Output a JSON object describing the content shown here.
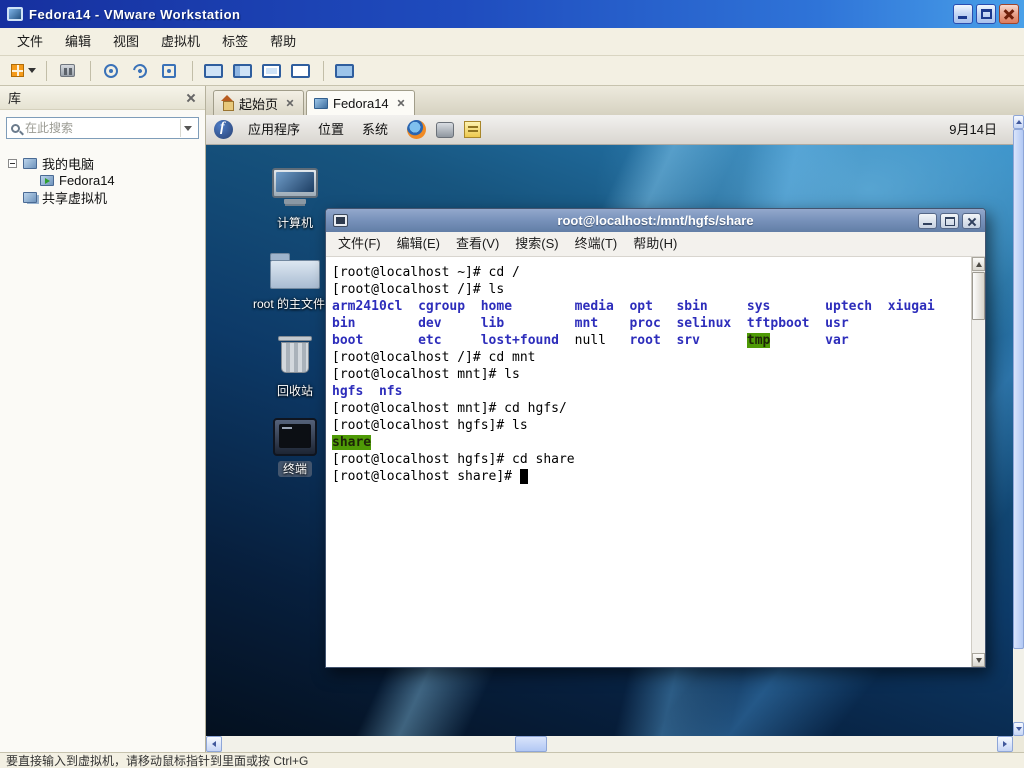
{
  "window": {
    "title": "Fedora14 - VMware Workstation",
    "menu": [
      "文件",
      "编辑",
      "视图",
      "虚拟机",
      "标签",
      "帮助"
    ]
  },
  "sidebar": {
    "title": "库",
    "search_placeholder": "在此搜索",
    "tree": {
      "my_computer": "我的电脑",
      "vm": "Fedora14",
      "shared": "共享虚拟机"
    }
  },
  "tabs": {
    "home": "起始页",
    "vm": "Fedora14"
  },
  "guest": {
    "panel": {
      "applications": "应用程序",
      "places": "位置",
      "system": "系统",
      "date": "9月14日"
    },
    "desktop_icons": {
      "computer": "计算机",
      "home": "root 的主文件夹",
      "trash": "回收站",
      "terminal": "终端"
    },
    "terminal": {
      "title": "root@localhost:/mnt/hgfs/share",
      "menu": [
        "文件(F)",
        "编辑(E)",
        "查看(V)",
        "搜索(S)",
        "终端(T)",
        "帮助(H)"
      ],
      "colors": {
        "directory": "#2d2dbb",
        "highlight_bg": "#4e9a06"
      },
      "lines": [
        [
          {
            "t": "[root@localhost ~]# cd /",
            "c": "p"
          }
        ],
        [
          {
            "t": "[root@localhost /]# ls",
            "c": "p"
          }
        ],
        [
          {
            "t": "arm2410cl",
            "c": "d"
          },
          {
            "t": "  ",
            "c": "p"
          },
          {
            "t": "cgroup",
            "c": "d"
          },
          {
            "t": "  ",
            "c": "p"
          },
          {
            "t": "home",
            "c": "d"
          },
          {
            "t": "        ",
            "c": "p"
          },
          {
            "t": "media",
            "c": "d"
          },
          {
            "t": "  ",
            "c": "p"
          },
          {
            "t": "opt",
            "c": "d"
          },
          {
            "t": "   ",
            "c": "p"
          },
          {
            "t": "sbin",
            "c": "d"
          },
          {
            "t": "     ",
            "c": "p"
          },
          {
            "t": "sys",
            "c": "d"
          },
          {
            "t": "       ",
            "c": "p"
          },
          {
            "t": "uptech",
            "c": "d"
          },
          {
            "t": "  ",
            "c": "p"
          },
          {
            "t": "xiugai",
            "c": "d"
          }
        ],
        [
          {
            "t": "bin",
            "c": "d"
          },
          {
            "t": "        ",
            "c": "p"
          },
          {
            "t": "dev",
            "c": "d"
          },
          {
            "t": "     ",
            "c": "p"
          },
          {
            "t": "lib",
            "c": "d"
          },
          {
            "t": "         ",
            "c": "p"
          },
          {
            "t": "mnt",
            "c": "d"
          },
          {
            "t": "    ",
            "c": "p"
          },
          {
            "t": "proc",
            "c": "d"
          },
          {
            "t": "  ",
            "c": "p"
          },
          {
            "t": "selinux",
            "c": "d"
          },
          {
            "t": "  ",
            "c": "p"
          },
          {
            "t": "tftpboot",
            "c": "d"
          },
          {
            "t": "  ",
            "c": "p"
          },
          {
            "t": "usr",
            "c": "d"
          }
        ],
        [
          {
            "t": "boot",
            "c": "d"
          },
          {
            "t": "       ",
            "c": "p"
          },
          {
            "t": "etc",
            "c": "d"
          },
          {
            "t": "     ",
            "c": "p"
          },
          {
            "t": "lost+found",
            "c": "d"
          },
          {
            "t": "  ",
            "c": "p"
          },
          {
            "t": "null",
            "c": "p"
          },
          {
            "t": "   ",
            "c": "p"
          },
          {
            "t": "root",
            "c": "d"
          },
          {
            "t": "  ",
            "c": "p"
          },
          {
            "t": "srv",
            "c": "d"
          },
          {
            "t": "      ",
            "c": "p"
          },
          {
            "t": "tmp",
            "c": "g"
          },
          {
            "t": "       ",
            "c": "p"
          },
          {
            "t": "var",
            "c": "d"
          }
        ],
        [
          {
            "t": "[root@localhost /]# cd mnt",
            "c": "p"
          }
        ],
        [
          {
            "t": "[root@localhost mnt]# ls",
            "c": "p"
          }
        ],
        [
          {
            "t": "hgfs",
            "c": "d"
          },
          {
            "t": "  ",
            "c": "p"
          },
          {
            "t": "nfs",
            "c": "d"
          }
        ],
        [
          {
            "t": "[root@localhost mnt]# cd hgfs/",
            "c": "p"
          }
        ],
        [
          {
            "t": "[root@localhost hgfs]# ls",
            "c": "p"
          }
        ],
        [
          {
            "t": "share",
            "c": "g"
          }
        ],
        [
          {
            "t": "[root@localhost hgfs]# cd share",
            "c": "p"
          }
        ],
        [
          {
            "t": "[root@localhost share]# ",
            "c": "p"
          },
          {
            "t": " ",
            "c": "cur"
          }
        ]
      ]
    }
  },
  "statusbar": "要直接输入到虚拟机，请移动鼠标指针到里面或按 Ctrl+G"
}
